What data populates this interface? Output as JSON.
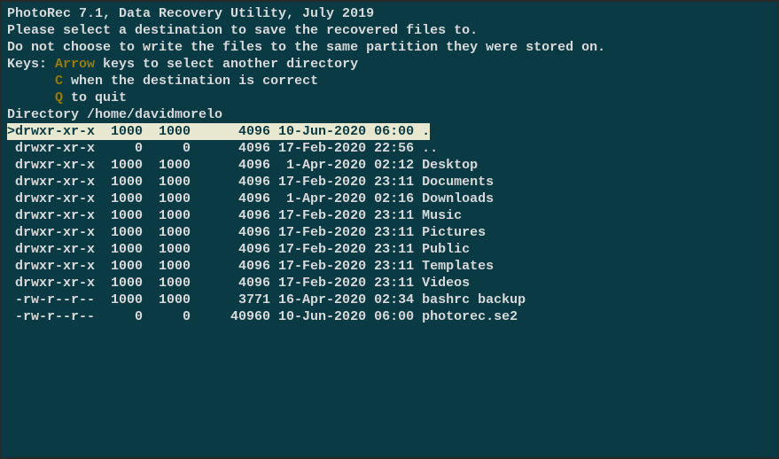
{
  "header": "PhotoRec 7.1, Data Recovery Utility, July 2019",
  "blank": "",
  "instr1": "Please select a destination to save the recovered files to.",
  "instr2": "Do not choose to write the files to the same partition they were stored on.",
  "keys_prefix": "Keys: ",
  "keys_arrow": "Arrow",
  "keys_arrow_rest": " keys to select another directory",
  "keys_c_pad": "      ",
  "keys_c": "C",
  "keys_c_rest": " when the destination is correct",
  "keys_q_pad": "      ",
  "keys_q": "Q",
  "keys_q_rest": " to quit",
  "dir_label": "Directory /home/davidmorelo",
  "rows": [
    {
      "sel": true,
      "perm": "drwxr-xr-x",
      "uid": "1000",
      "gid": "1000",
      "size": "4096",
      "date": "10-Jun-2020",
      "time": "06:00",
      "name": "."
    },
    {
      "sel": false,
      "perm": "drwxr-xr-x",
      "uid": "0",
      "gid": "0",
      "size": "4096",
      "date": "17-Feb-2020",
      "time": "22:56",
      "name": ".."
    },
    {
      "sel": false,
      "perm": "drwxr-xr-x",
      "uid": "1000",
      "gid": "1000",
      "size": "4096",
      "date": " 1-Apr-2020",
      "time": "02:12",
      "name": "Desktop"
    },
    {
      "sel": false,
      "perm": "drwxr-xr-x",
      "uid": "1000",
      "gid": "1000",
      "size": "4096",
      "date": "17-Feb-2020",
      "time": "23:11",
      "name": "Documents"
    },
    {
      "sel": false,
      "perm": "drwxr-xr-x",
      "uid": "1000",
      "gid": "1000",
      "size": "4096",
      "date": " 1-Apr-2020",
      "time": "02:16",
      "name": "Downloads"
    },
    {
      "sel": false,
      "perm": "drwxr-xr-x",
      "uid": "1000",
      "gid": "1000",
      "size": "4096",
      "date": "17-Feb-2020",
      "time": "23:11",
      "name": "Music"
    },
    {
      "sel": false,
      "perm": "drwxr-xr-x",
      "uid": "1000",
      "gid": "1000",
      "size": "4096",
      "date": "17-Feb-2020",
      "time": "23:11",
      "name": "Pictures"
    },
    {
      "sel": false,
      "perm": "drwxr-xr-x",
      "uid": "1000",
      "gid": "1000",
      "size": "4096",
      "date": "17-Feb-2020",
      "time": "23:11",
      "name": "Public"
    },
    {
      "sel": false,
      "perm": "drwxr-xr-x",
      "uid": "1000",
      "gid": "1000",
      "size": "4096",
      "date": "17-Feb-2020",
      "time": "23:11",
      "name": "Templates"
    },
    {
      "sel": false,
      "perm": "drwxr-xr-x",
      "uid": "1000",
      "gid": "1000",
      "size": "4096",
      "date": "17-Feb-2020",
      "time": "23:11",
      "name": "Videos"
    },
    {
      "sel": false,
      "perm": "-rw-r--r--",
      "uid": "1000",
      "gid": "1000",
      "size": "3771",
      "date": "16-Apr-2020",
      "time": "02:34",
      "name": "bashrc backup"
    },
    {
      "sel": false,
      "perm": "-rw-r--r--",
      "uid": "0",
      "gid": "0",
      "size": "40960",
      "date": "10-Jun-2020",
      "time": "06:00",
      "name": "photorec.se2"
    }
  ]
}
